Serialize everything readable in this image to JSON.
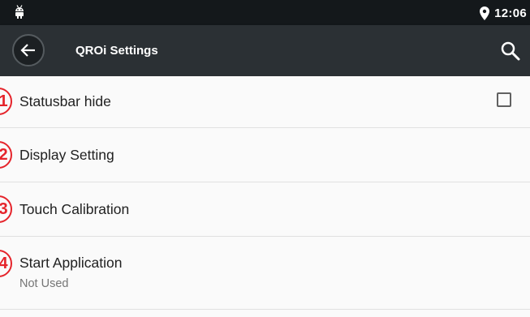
{
  "status_bar": {
    "time": "12:06",
    "left_icon": "android-icon",
    "right_icon": "location-icon"
  },
  "app_bar": {
    "title": "QROi Settings",
    "back_icon": "back-arrow-icon",
    "search_icon": "search-icon"
  },
  "settings": {
    "items": [
      {
        "number": "1",
        "label": "Statusbar hide",
        "has_checkbox": true,
        "checked": false
      },
      {
        "number": "2",
        "label": "Display Setting"
      },
      {
        "number": "3",
        "label": "Touch Calibration"
      },
      {
        "number": "4",
        "label": "Start Application",
        "summary": "Not Used"
      }
    ]
  },
  "colors": {
    "status_bar": "#14181b",
    "app_bar": "#2b3034",
    "background": "#fafafa",
    "annotation": "#e5242b"
  }
}
